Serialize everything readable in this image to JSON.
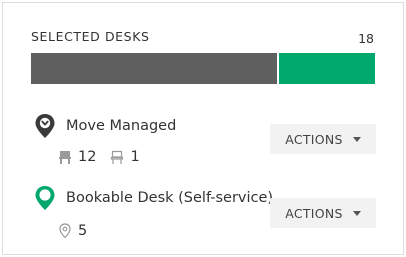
{
  "header": {
    "title": "SELECTED DESKS",
    "count": "18"
  },
  "bar": {
    "segments": [
      {
        "name": "move-managed",
        "fraction": 0.72,
        "color": "#5f5f5f"
      },
      {
        "name": "bookable",
        "fraction": 0.28,
        "color": "#00a86b"
      }
    ]
  },
  "groups": [
    {
      "label": "Move Managed",
      "pin_color": "#3a3a3a",
      "stats": [
        {
          "icon": "desk-icon",
          "value": "12"
        },
        {
          "icon": "empty-desk-icon",
          "value": "1"
        }
      ],
      "actions_label": "ACTIONS"
    },
    {
      "label": "Bookable Desk (Self-service)",
      "pin_color": "#00a86b",
      "stats": [
        {
          "icon": "location-pin-icon",
          "value": "5"
        }
      ],
      "actions_label": "ACTIONS"
    }
  ]
}
